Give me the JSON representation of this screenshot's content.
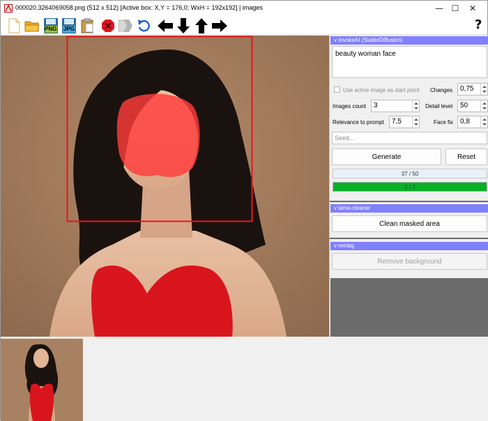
{
  "window": {
    "title": "000020.3264069058.png (512 x 512) [Active box: X,Y = 176,0; WxH = 192x192] | images",
    "controls": {
      "minimize": "—",
      "maximize": "☐",
      "close": "✕"
    }
  },
  "toolbar": {
    "items": [
      "new-icon",
      "open-folder-icon",
      "save-png-icon",
      "save-jpg-icon",
      "paste-icon",
      "delete-icon",
      "shift-icon",
      "undo-icon",
      "arrow-left-icon",
      "arrow-down-icon",
      "arrow-up-icon",
      "arrow-right-icon"
    ],
    "png_label": "PNG",
    "jpg_label": "JPG",
    "help_label": "?"
  },
  "invokeai": {
    "header": "v InvokeAI (StableDiffusion)",
    "prompt": "beauty woman face",
    "use_active_image_label": "Use active image as start point",
    "use_active_image_checked": false,
    "changes_label": "Changes",
    "changes_value": "0,75",
    "images_count_label": "Images count",
    "images_count_value": "3",
    "detail_level_label": "Detail level",
    "detail_level_value": "50",
    "relevance_label": "Relevance to prompt",
    "relevance_value": "7,5",
    "face_fix_label": "Face fix",
    "face_fix_value": "0,8",
    "seed_placeholder": "Seed...",
    "generate_label": "Generate",
    "reset_label": "Reset",
    "steps_progress": "37 / 50",
    "steps_fraction": 0.0,
    "images_progress": "2 / 2",
    "images_fraction": 1.0
  },
  "lama": {
    "header": "v lama-cleaner",
    "clean_label": "Clean masked area"
  },
  "rembg": {
    "header": "v rembg",
    "remove_label": "Remove background"
  },
  "colors": {
    "accent": "#8080ff",
    "selection": "#e8161c",
    "mask": "#ff3c3c",
    "progress_green": "#06b025"
  }
}
